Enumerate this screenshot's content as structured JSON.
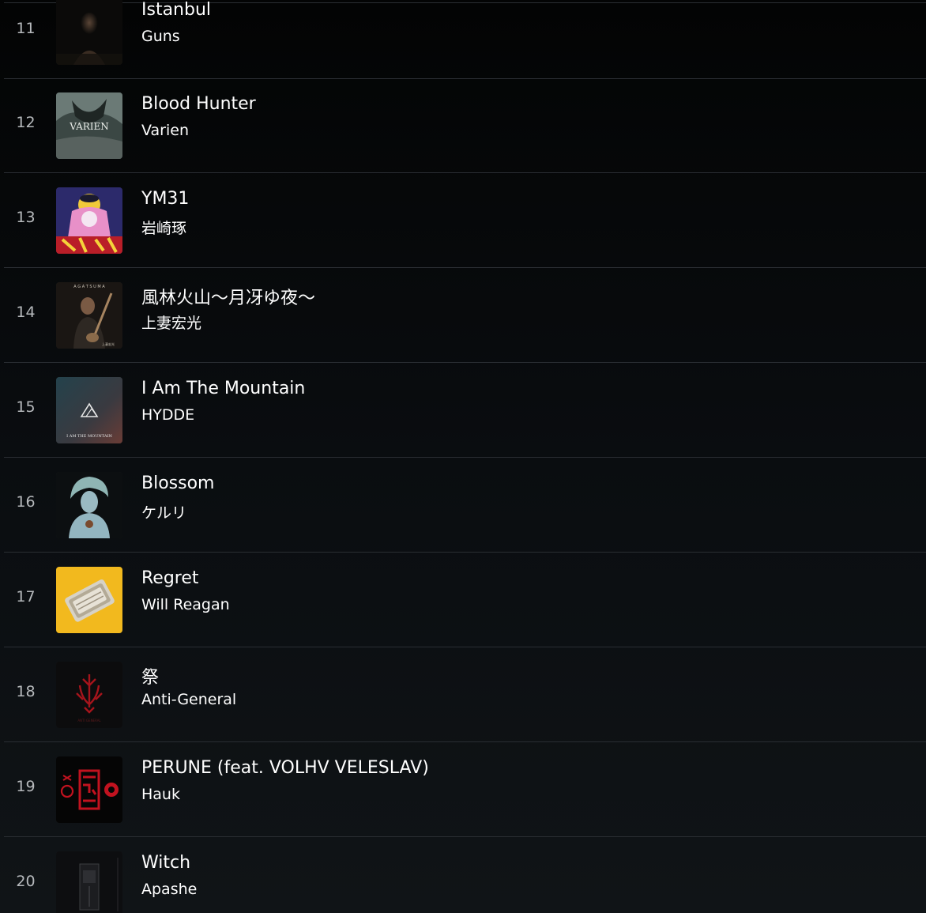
{
  "tracks": [
    {
      "rank": "11",
      "title": "Istanbul",
      "artist": "Guns",
      "art": "dark-portrait-cover"
    },
    {
      "rank": "12",
      "title": "Blood Hunter",
      "artist": "Varien",
      "art": "varien-dragon-cover",
      "art_text": "VARIEN"
    },
    {
      "rank": "13",
      "title": "YM31",
      "artist": "岩崎琢",
      "art": "anime-illustration-cover"
    },
    {
      "rank": "14",
      "title": "風林火山〜月冴ゆ夜〜",
      "artist": "上妻宏光",
      "art": "shamisen-player-cover",
      "art_text": "A G A T S U M A"
    },
    {
      "rank": "15",
      "title": "I Am The Mountain",
      "artist": "HYDDE",
      "art": "mountain-triangle-cover",
      "art_text": "I AM THE MOUNTAIN"
    },
    {
      "rank": "16",
      "title": "Blossom",
      "artist": "ケルリ",
      "art": "pale-figure-cover"
    },
    {
      "rank": "17",
      "title": "Regret",
      "artist": "Will Reagan",
      "art": "yellow-tin-cover"
    },
    {
      "rank": "18",
      "title": "祭",
      "artist": "Anti-General",
      "art": "red-emblem-cover"
    },
    {
      "rank": "19",
      "title": "PERUNE (feat. VOLHV VELESLAV)",
      "artist": "Hauk",
      "art": "red-glyph-cover"
    },
    {
      "rank": "20",
      "title": "Witch",
      "artist": "Apashe",
      "art": "dark-frame-cover"
    }
  ],
  "colors": {
    "background": "#0a0d10",
    "divider": "#2a2e33",
    "rank_text": "#b6b9bc",
    "title_text": "#ffffff",
    "yellow_cover": "#f2b91e",
    "red_accent": "#c1121f"
  }
}
